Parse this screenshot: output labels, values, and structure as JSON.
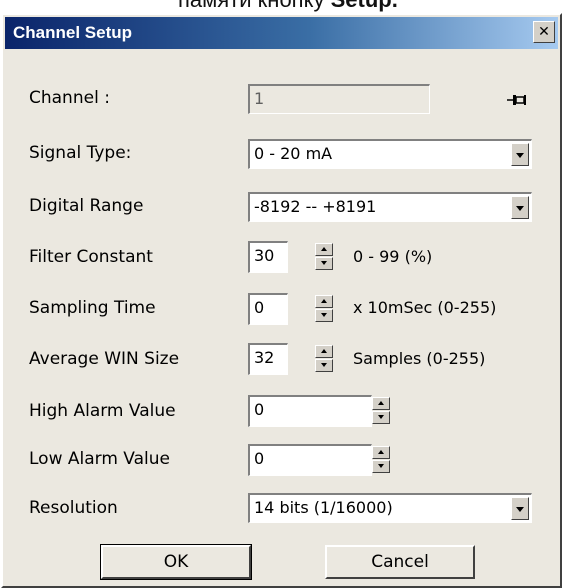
{
  "caption": {
    "text_partial": "памяти кнопку",
    "bold_word": "Setup."
  },
  "dialog": {
    "title": "Channel Setup",
    "close_glyph": "✕"
  },
  "fields": {
    "channel": {
      "label": "Channel :",
      "value": "1"
    },
    "signal_type": {
      "label": "Signal Type:",
      "value": "0 - 20 mA"
    },
    "digital_range": {
      "label": "Digital Range",
      "value": "-8192 -- +8191"
    },
    "filter_constant": {
      "label": "Filter Constant",
      "value": "30",
      "range": "0 - 99 (%)"
    },
    "sampling_time": {
      "label": "Sampling Time",
      "value": "0",
      "range": "x 10mSec (0-255)"
    },
    "average_win": {
      "label": "Average WIN Size",
      "value": "32",
      "range": "Samples (0-255)"
    },
    "high_alarm": {
      "label": "High Alarm Value",
      "value": "0"
    },
    "low_alarm": {
      "label": "Low Alarm Value",
      "value": "0"
    },
    "resolution": {
      "label": "Resolution",
      "value": "14 bits (1/16000)"
    }
  },
  "buttons": {
    "ok": "OK",
    "cancel": "Cancel"
  },
  "icons": {
    "pin": "pushpin-icon"
  }
}
